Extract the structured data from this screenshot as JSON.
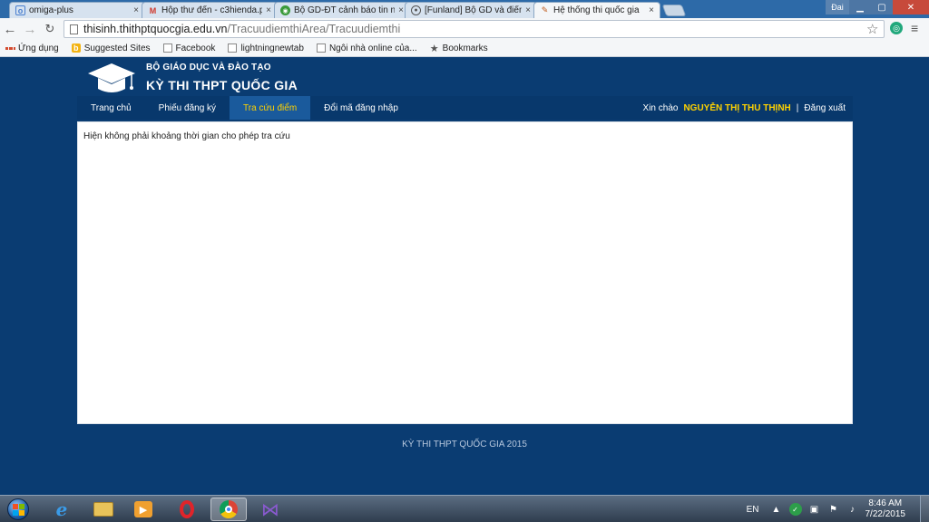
{
  "browser": {
    "tabs": [
      {
        "title": "omiga-plus",
        "icon": "omiga-icon",
        "active": false
      },
      {
        "title": "Hộp thư đến - c3hienda.p",
        "icon": "gmail-icon",
        "active": false
      },
      {
        "title": "Bộ GD-ĐT cảnh báo tin nh",
        "icon": "news-icon",
        "active": false
      },
      {
        "title": "[Funland] Bộ GD và điểm",
        "icon": "forum-icon",
        "active": false
      },
      {
        "title": "Hệ thống thi quốc gia",
        "icon": "pen-icon",
        "active": true
      }
    ],
    "close_glyph": "×",
    "user_label": "Đai",
    "url_host": "thisinh.thithptquocgia.edu.vn",
    "url_path": "/TracuudiemthiArea/Tracuudiemthi"
  },
  "bookmarks": [
    {
      "label": "Ứng dụng",
      "icon": "apps-icon"
    },
    {
      "label": "Suggested Sites",
      "icon": "bing-icon"
    },
    {
      "label": "Facebook",
      "icon": "page-icon"
    },
    {
      "label": "lightningnewtab",
      "icon": "page-icon"
    },
    {
      "label": "Ngôi nhà online của...",
      "icon": "page-icon"
    },
    {
      "label": "Bookmarks",
      "icon": "star-icon"
    }
  ],
  "site": {
    "org": "BỘ GIÁO DỤC VÀ ĐÀO TẠO",
    "exam_title": "KỲ THI THPT QUỐC GIA",
    "nav": [
      {
        "label": "Trang chủ",
        "active": false
      },
      {
        "label": "Phiếu đăng ký",
        "active": false
      },
      {
        "label": "Tra cứu điểm",
        "active": true
      },
      {
        "label": "Đổi mã đăng nhập",
        "active": false
      }
    ],
    "greeting": "Xin chào",
    "username": "NGUYỄN THỊ THU THỊNH",
    "separator": "|",
    "logout": "Đăng xuất",
    "message": "Hiện không phải khoảng thời gian cho phép tra cứu",
    "footer": "KỲ THI THPT QUỐC GIA 2015",
    "colors": {
      "primary": "#0a3c72",
      "accent": "#ffd200",
      "nav_active": "#1a5a9c"
    }
  },
  "taskbar": {
    "apps": [
      "ie-icon",
      "explorer-icon",
      "media-player-icon",
      "opera-icon",
      "chrome-icon",
      "visual-studio-icon"
    ],
    "language": "EN",
    "time": "8:46 AM",
    "date": "7/22/2015"
  }
}
